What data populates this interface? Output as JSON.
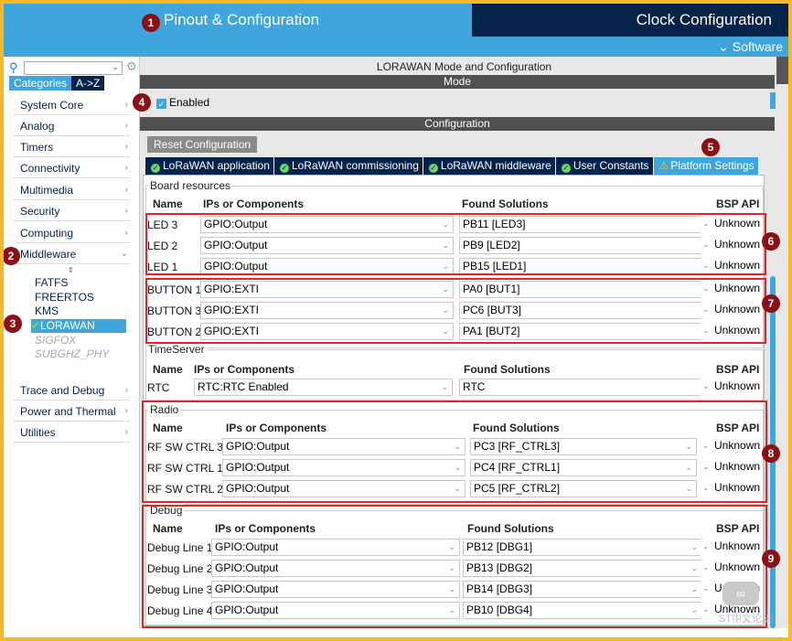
{
  "header": {
    "pinout": "Pinout & Configuration",
    "clock": "Clock Configuration",
    "software": "⌄ Software"
  },
  "sidebar": {
    "tabs": [
      "Categories",
      "A->Z"
    ],
    "categories": [
      "System Core",
      "Analog",
      "Timers",
      "Connectivity",
      "Multimedia",
      "Security",
      "Computing",
      "Middleware",
      "Trace and Debug",
      "Power and Thermal",
      "Utilities"
    ],
    "middleware_children": [
      "FATFS",
      "FREERTOS",
      "KMS"
    ],
    "selected": "LORAWAN",
    "disabled_children": [
      "SIGFOX",
      "SUBGHZ_PHY"
    ]
  },
  "main": {
    "title": "LORAWAN Mode and Configuration",
    "mode_label": "Mode",
    "enabled_label": "Enabled",
    "config_label": "Configuration",
    "reset_label": "Reset Configuration",
    "tabs": [
      "LoRaWAN application",
      "LoRaWAN commissioning",
      "LoRaWAN middleware",
      "User Constants",
      "Platform Settings"
    ]
  },
  "table_headers": {
    "name": "Name",
    "ips": "IPs or Components",
    "found": "Found Solutions",
    "bsp": "BSP API"
  },
  "groups": {
    "board": {
      "label": "Board resources",
      "rows": [
        {
          "name": "LED 3",
          "ip": "GPIO:Output",
          "found": "PB11 [LED3]",
          "bsp": "Unknown"
        },
        {
          "name": "LED 2",
          "ip": "GPIO:Output",
          "found": "PB9 [LED2]",
          "bsp": "Unknown"
        },
        {
          "name": "LED 1",
          "ip": "GPIO:Output",
          "found": "PB15 [LED1]",
          "bsp": "Unknown"
        },
        {
          "name": "BUTTON 1",
          "ip": "GPIO:EXTI",
          "found": "PA0 [BUT1]",
          "bsp": "Unknown"
        },
        {
          "name": "BUTTON 3",
          "ip": "GPIO:EXTI",
          "found": "PC6 [BUT3]",
          "bsp": "Unknown"
        },
        {
          "name": "BUTTON 2",
          "ip": "GPIO:EXTI",
          "found": "PA1 [BUT2]",
          "bsp": "Unknown"
        }
      ]
    },
    "timeserver": {
      "label": "TimeServer",
      "rows": [
        {
          "name": "RTC",
          "ip": "RTC:RTC Enabled",
          "found": "RTC",
          "bsp": "Unknown"
        }
      ]
    },
    "radio": {
      "label": "Radio",
      "rows": [
        {
          "name": "RF SW CTRL 3",
          "ip": "GPIO:Output",
          "found": "PC3 [RF_CTRL3]",
          "bsp": "Unknown"
        },
        {
          "name": "RF SW CTRL 1",
          "ip": "GPIO:Output",
          "found": "PC4 [RF_CTRL1]",
          "bsp": "Unknown"
        },
        {
          "name": "RF SW CTRL 2",
          "ip": "GPIO:Output",
          "found": "PC5 [RF_CTRL2]",
          "bsp": "Unknown"
        }
      ]
    },
    "debug": {
      "label": "Debug",
      "rows": [
        {
          "name": "Debug Line 1",
          "ip": "GPIO:Output",
          "found": "PB12 [DBG1]",
          "bsp": "Unknown"
        },
        {
          "name": "Debug Line 2",
          "ip": "GPIO:Output",
          "found": "PB13 [DBG2]",
          "bsp": "Unknown"
        },
        {
          "name": "Debug Line 3",
          "ip": "GPIO:Output",
          "found": "PB14 [DBG3]",
          "bsp": "Unknown"
        },
        {
          "name": "Debug Line 4",
          "ip": "GPIO:Output",
          "found": "PB10 [DBG4]",
          "bsp": "Unknown"
        }
      ]
    }
  },
  "badges": [
    "1",
    "2",
    "3",
    "4",
    "5",
    "6",
    "7",
    "8",
    "9"
  ],
  "watermark": "ST中文论坛",
  "colors": {
    "accent": "#3fa6dd",
    "navy": "#03234b",
    "highlight": "#e0242c",
    "badge": "#8b0f14",
    "frame": "#f6b92a"
  }
}
